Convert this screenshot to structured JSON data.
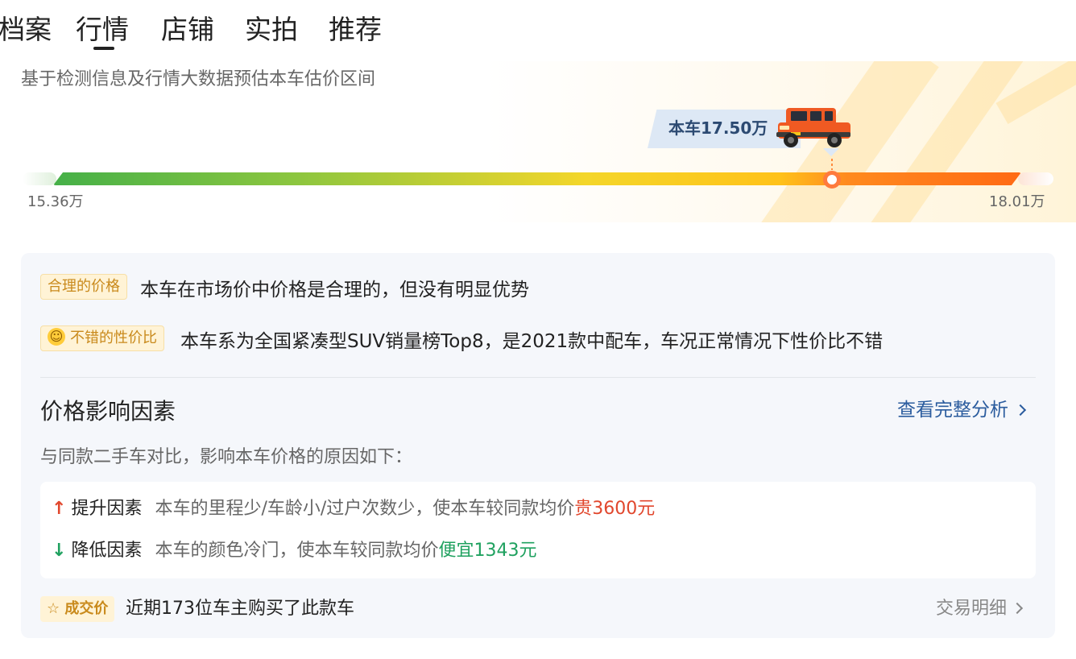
{
  "tabs": [
    {
      "label": "档案",
      "active": false
    },
    {
      "label": "行情",
      "active": true
    },
    {
      "label": "店铺",
      "active": false
    },
    {
      "label": "实拍",
      "active": false
    },
    {
      "label": "推荐",
      "active": false
    }
  ],
  "estimate": {
    "subtitle": "基于检测信息及行情大数据预估本车估价区间",
    "current_label": "本车17.50万",
    "min_label": "15.36万",
    "max_label": "18.01万",
    "min_value": 15.36,
    "max_value": 18.01,
    "current_value": 17.5
  },
  "analysis": {
    "items": [
      {
        "tag": "合理的价格",
        "text": "本车在市场价中价格是合理的，但没有明显优势"
      },
      {
        "tag": "不错的性价比",
        "text": "本车系为全国紧凑型SUV销量榜Top8，是2021款中配车，车况正常情况下性价比不错"
      }
    ],
    "factors_title": "价格影响因素",
    "view_link": "查看完整分析",
    "factors_subtitle": "与同款二手车对比，影响本车价格的原因如下：",
    "factors": {
      "up": {
        "label": "提升因素",
        "desc": "本车的里程少/车龄小/过户次数少，使本车较同款均价",
        "amount": "贵3600元"
      },
      "down": {
        "label": "降低因素",
        "desc": "本车的颜色冷门，使本车较同款均价",
        "amount": "便宜1343元"
      }
    },
    "deal": {
      "tag": "成交价",
      "text": "近期173位车主购买了此款车",
      "link": "交易明细"
    }
  },
  "colors": {
    "accent_orange": "#ff7a3d",
    "link_blue": "#2b5c9e",
    "up_red": "#e1472d",
    "down_green": "#1fa15f",
    "tag_bg": "#fff3d6",
    "tag_text": "#c98a1c"
  },
  "icons": {
    "up": "arrow-up-icon",
    "down": "arrow-down-icon",
    "smile": "smile-icon",
    "chevron": "chevron-right-icon"
  }
}
